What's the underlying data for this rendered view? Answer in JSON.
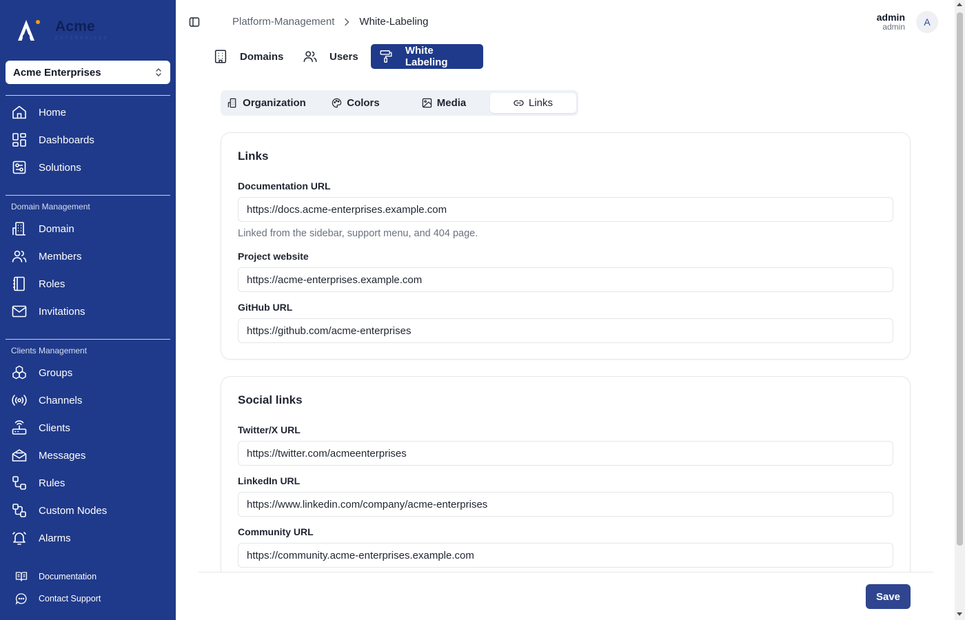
{
  "brand": {
    "name": "Acme",
    "tagline": "ENTERPRISES",
    "accent": "#f59e0b",
    "sidebar_bg": "#1f3a8a"
  },
  "org_selector": {
    "value": "Acme Enterprises"
  },
  "sidebar": {
    "main": [
      {
        "label": "Home",
        "icon": "home-icon"
      },
      {
        "label": "Dashboards",
        "icon": "dashboard-icon"
      },
      {
        "label": "Solutions",
        "icon": "solutions-icon"
      }
    ],
    "domain_section": {
      "title": "Domain Management",
      "items": [
        {
          "label": "Domain",
          "icon": "building-icon"
        },
        {
          "label": "Members",
          "icon": "users-icon"
        },
        {
          "label": "Roles",
          "icon": "notebook-icon"
        },
        {
          "label": "Invitations",
          "icon": "mail-icon"
        }
      ]
    },
    "clients_section": {
      "title": "Clients Management",
      "items": [
        {
          "label": "Groups",
          "icon": "boxes-icon"
        },
        {
          "label": "Channels",
          "icon": "radio-icon"
        },
        {
          "label": "Clients",
          "icon": "router-icon"
        },
        {
          "label": "Messages",
          "icon": "mail-open-icon"
        },
        {
          "label": "Rules",
          "icon": "workflow-icon"
        },
        {
          "label": "Custom Nodes",
          "icon": "custom-nodes-icon"
        },
        {
          "label": "Alarms",
          "icon": "bell-icon"
        }
      ]
    },
    "footer": [
      {
        "label": "Documentation",
        "icon": "book-icon"
      },
      {
        "label": "Contact Support",
        "icon": "chat-icon"
      }
    ]
  },
  "header": {
    "breadcrumb": [
      "Platform-Management",
      "White-Labeling"
    ],
    "user": {
      "name": "admin",
      "role": "admin",
      "initial": "A"
    }
  },
  "top_tabs": [
    {
      "label": "Domains",
      "icon": "building-icon",
      "active": false
    },
    {
      "label": "Users",
      "icon": "users-icon",
      "active": false
    },
    {
      "label": "White Labeling",
      "icon": "paint-roller-icon",
      "active": true
    }
  ],
  "sub_tabs": [
    {
      "label": "Organization",
      "icon": "building-icon",
      "active": false
    },
    {
      "label": "Colors",
      "icon": "palette-icon",
      "active": false
    },
    {
      "label": "Media",
      "icon": "image-icon",
      "active": false
    },
    {
      "label": "Links",
      "icon": "link-icon",
      "active": true
    }
  ],
  "links_card": {
    "title": "Links",
    "fields": [
      {
        "label": "Documentation URL",
        "value": "https://docs.acme-enterprises.example.com",
        "help": "Linked from the sidebar, support menu, and 404 page."
      },
      {
        "label": "Project website",
        "value": "https://acme-enterprises.example.com"
      },
      {
        "label": "GitHub URL",
        "value": "https://github.com/acme-enterprises"
      }
    ]
  },
  "social_card": {
    "title": "Social links",
    "fields": [
      {
        "label": "Twitter/X URL",
        "value": "https://twitter.com/acmeenterprises"
      },
      {
        "label": "LinkedIn URL",
        "value": "https://www.linkedin.com/company/acme-enterprises"
      },
      {
        "label": "Community URL",
        "value": "https://community.acme-enterprises.example.com"
      }
    ]
  },
  "actions": {
    "save_label": "Save"
  }
}
